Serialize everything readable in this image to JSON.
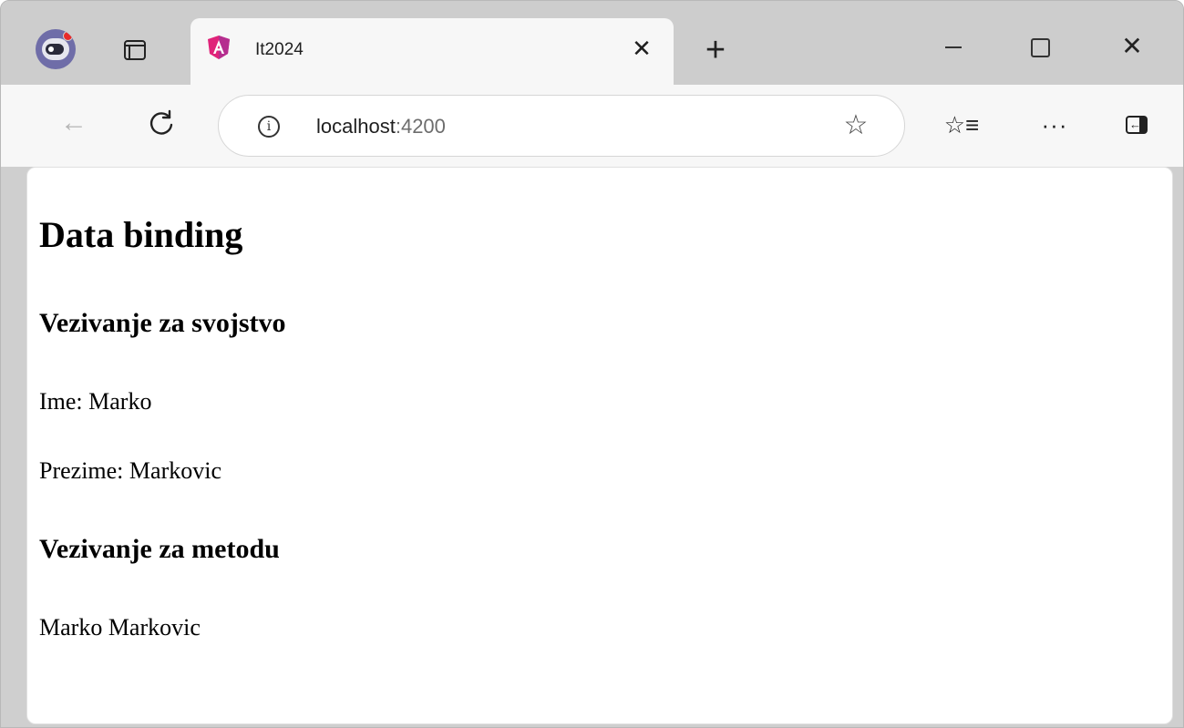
{
  "browser": {
    "tab": {
      "title": "It2024",
      "close_glyph": "✕"
    },
    "newtab_glyph": "+",
    "window_controls": {
      "close_glyph": "✕"
    },
    "toolbar": {
      "back_glyph": "←",
      "reload_glyph": "C",
      "info_glyph": "i",
      "url_host": "localhost",
      "url_port": ":4200",
      "star_glyph": "☆",
      "favorites_glyph": "☆≡",
      "more_glyph": "···"
    },
    "icons": {
      "profile": "profile-avatar-icon",
      "tab_actions": "tab-actions-icon",
      "favicon": "angular-icon",
      "sidebar": "sidebar-toggle-icon"
    },
    "colors": {
      "angular_favicon": "#e0237a",
      "profile_badge": "#e82a2a"
    }
  },
  "page": {
    "heading": "Data binding",
    "property_section": {
      "heading": "Vezivanje za svojstvo",
      "ime_line": "Ime: Marko",
      "prezime_line": "Prezime: Markovic"
    },
    "method_section": {
      "heading": "Vezivanje za metodu",
      "full_name": "Marko Markovic"
    }
  }
}
